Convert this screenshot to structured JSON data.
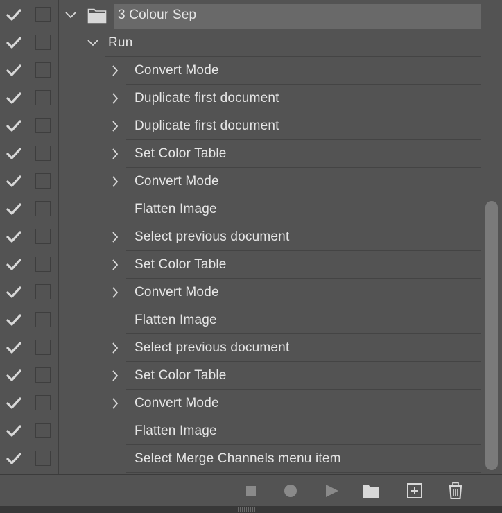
{
  "actions": [
    {
      "label": "3 Colour Sep",
      "level": 0,
      "expandable": true,
      "expanded": true,
      "checked": true,
      "folder": true,
      "selected": true
    },
    {
      "label": "Run",
      "level": 1,
      "expandable": true,
      "expanded": true,
      "checked": true
    },
    {
      "label": "Convert Mode",
      "level": 2,
      "expandable": true,
      "expanded": false,
      "checked": true
    },
    {
      "label": "Duplicate first document",
      "level": 2,
      "expandable": true,
      "expanded": false,
      "checked": true
    },
    {
      "label": "Duplicate first document",
      "level": 2,
      "expandable": true,
      "expanded": false,
      "checked": true
    },
    {
      "label": "Set Color Table",
      "level": 2,
      "expandable": true,
      "expanded": false,
      "checked": true
    },
    {
      "label": "Convert Mode",
      "level": 2,
      "expandable": true,
      "expanded": false,
      "checked": true
    },
    {
      "label": "Flatten Image",
      "level": 2,
      "expandable": false,
      "expanded": false,
      "checked": true
    },
    {
      "label": "Select previous document",
      "level": 2,
      "expandable": true,
      "expanded": false,
      "checked": true
    },
    {
      "label": "Set Color Table",
      "level": 2,
      "expandable": true,
      "expanded": false,
      "checked": true
    },
    {
      "label": "Convert Mode",
      "level": 2,
      "expandable": true,
      "expanded": false,
      "checked": true
    },
    {
      "label": "Flatten Image",
      "level": 2,
      "expandable": false,
      "expanded": false,
      "checked": true
    },
    {
      "label": "Select previous document",
      "level": 2,
      "expandable": true,
      "expanded": false,
      "checked": true
    },
    {
      "label": "Set Color Table",
      "level": 2,
      "expandable": true,
      "expanded": false,
      "checked": true
    },
    {
      "label": "Convert Mode",
      "level": 2,
      "expandable": true,
      "expanded": false,
      "checked": true
    },
    {
      "label": "Flatten Image",
      "level": 2,
      "expandable": false,
      "expanded": false,
      "checked": true
    },
    {
      "label": "Select Merge Channels menu item",
      "level": 2,
      "expandable": false,
      "expanded": false,
      "checked": true
    }
  ],
  "toolbar": {
    "buttons": [
      {
        "name": "stop-button",
        "icon": "stop-icon",
        "enabled": false
      },
      {
        "name": "record-button",
        "icon": "record-icon",
        "enabled": false
      },
      {
        "name": "play-button",
        "icon": "play-icon",
        "enabled": false
      },
      {
        "name": "new-set-button",
        "icon": "folder-icon",
        "enabled": true
      },
      {
        "name": "new-action-button",
        "icon": "new-item-icon",
        "enabled": true
      },
      {
        "name": "delete-button",
        "icon": "trash-icon",
        "enabled": true
      }
    ]
  },
  "colors": {
    "panel": "#535353",
    "selected_row": "#696969",
    "text": "#e6e6e6",
    "icon": "#d8d8d8",
    "disabled_icon": "#8a8a8a"
  }
}
